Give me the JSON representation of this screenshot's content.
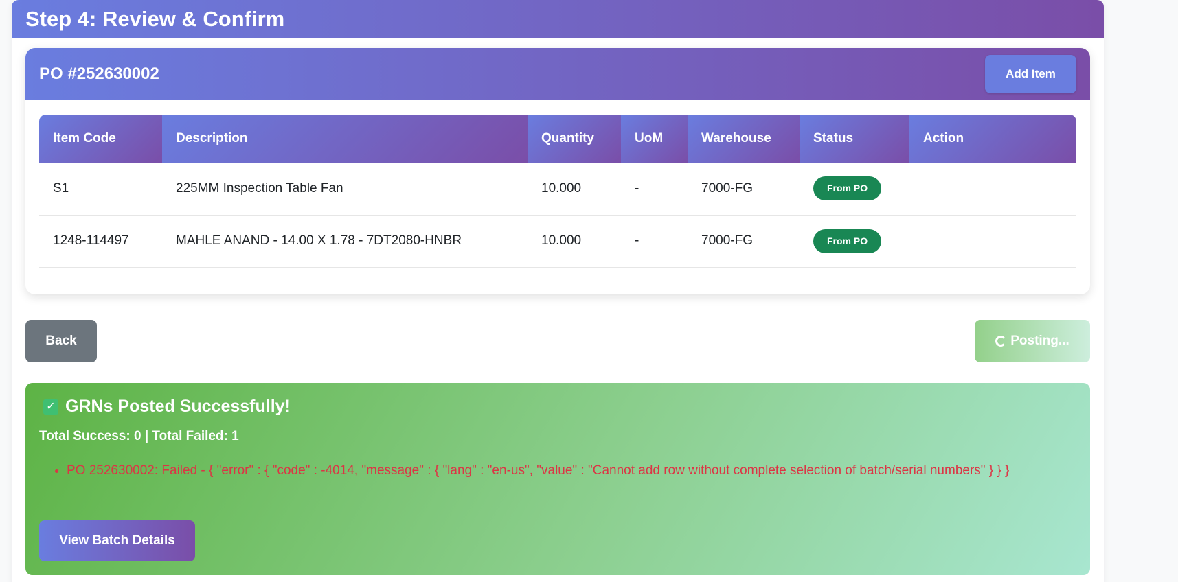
{
  "step": {
    "title": "Step 4: Review & Confirm"
  },
  "po": {
    "title": "PO #252630002",
    "add_item_label": "Add Item",
    "columns": [
      "Item Code",
      "Description",
      "Quantity",
      "UoM",
      "Warehouse",
      "Status",
      "Action"
    ],
    "rows": [
      {
        "item_code": "S1",
        "description": "225MM Inspection Table Fan",
        "quantity": "10.000",
        "uom": "-",
        "warehouse": "7000-FG",
        "status": "From PO",
        "action": ""
      },
      {
        "item_code": "1248-114497",
        "description": "MAHLE ANAND - 14.00 X 1.78 - 7DT2080-HNBR",
        "quantity": "10.000",
        "uom": "-",
        "warehouse": "7000-FG",
        "status": "From PO",
        "action": ""
      }
    ]
  },
  "actions": {
    "back_label": "Back",
    "posting_label": "Posting..."
  },
  "result": {
    "icon": "check-box-icon",
    "title": "GRNs Posted Successfully!",
    "summary": "Total Success: 0 | Total Failed: 1",
    "errors": [
      "PO 252630002: Failed - { \"error\" : { \"code\" : -4014, \"message\" : { \"lang\" : \"en-us\", \"value\" : \"Cannot add row without complete selection of batch/serial numbers\" } } }"
    ],
    "view_batch_label": "View Batch Details"
  },
  "colors": {
    "gradient_start": "#6a7ddf",
    "gradient_end": "#7a4ea8",
    "badge": "#198754",
    "error_text": "#dc3545",
    "success_start": "#5db345",
    "success_end": "#a8e6d0"
  }
}
